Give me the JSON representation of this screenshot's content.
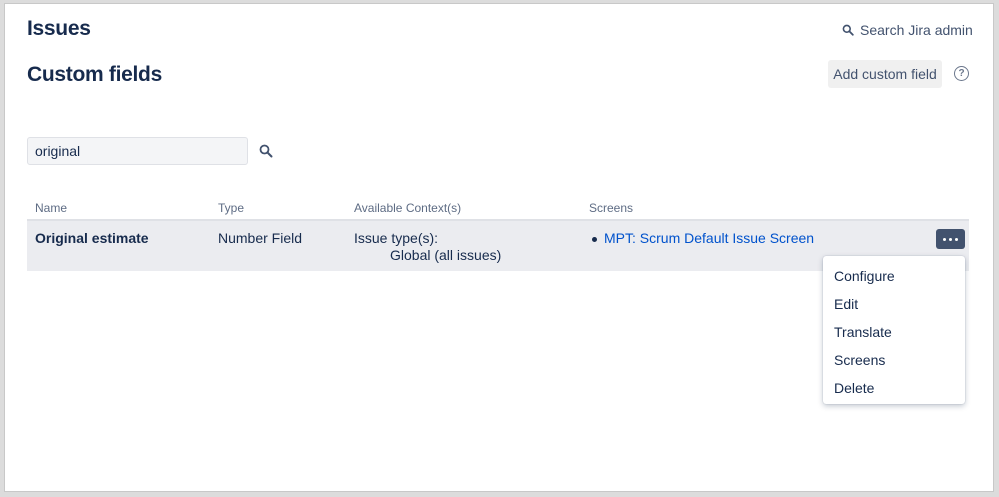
{
  "header": {
    "section_title": "Issues",
    "search_admin_label": "Search Jira admin"
  },
  "page": {
    "title": "Custom fields",
    "add_button_label": "Add custom field",
    "help_glyph": "?"
  },
  "filter": {
    "value": "original"
  },
  "table": {
    "headers": {
      "name": "Name",
      "type": "Type",
      "contexts": "Available Context(s)",
      "screens": "Screens"
    },
    "rows": [
      {
        "name": "Original estimate",
        "type": "Number Field",
        "context_label": "Issue type(s):",
        "context_value": "Global (all issues)",
        "screen": "MPT: Scrum Default Issue Screen"
      }
    ]
  },
  "actions_menu": {
    "items": [
      {
        "label": "Configure"
      },
      {
        "label": "Edit"
      },
      {
        "label": "Translate"
      },
      {
        "label": "Screens"
      },
      {
        "label": "Delete"
      }
    ]
  },
  "icons": {
    "search": "search-icon",
    "filter_search": "search-icon",
    "help": "help-icon",
    "more": "more-icon"
  },
  "colors": {
    "title": "#172b4d",
    "link": "#0052cc",
    "more_button": "#42526e",
    "row_background": "#ebecf0",
    "muted_text": "#5e6c84"
  }
}
